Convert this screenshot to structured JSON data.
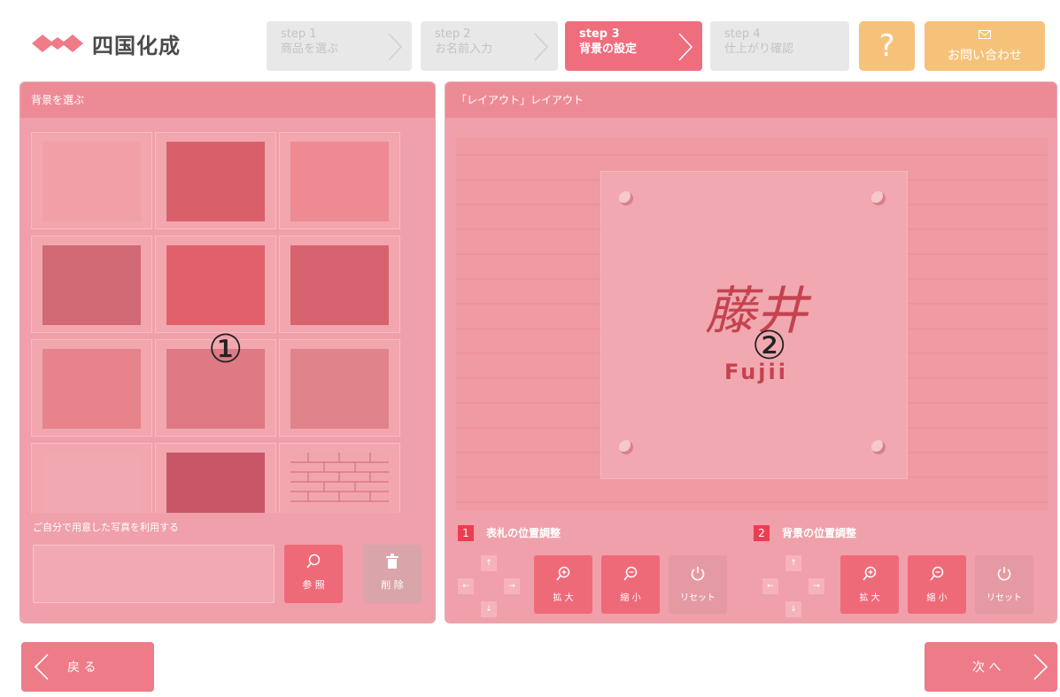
{
  "brand": {
    "name": "四国化成"
  },
  "steps": [
    {
      "title": "step 1",
      "label": "商品を選ぶ"
    },
    {
      "title": "step 2",
      "label": "お名前入力"
    },
    {
      "title": "step 3",
      "label": "背景の設定"
    },
    {
      "title": "step 4",
      "label": "仕上がり確認"
    }
  ],
  "header": {
    "help_label": "?",
    "contact_label": "お問い合わせ"
  },
  "left_panel": {
    "title": "背景を選ぶ",
    "annotation": "①",
    "own_photo_label": "ご自分で用意した写真を利用する",
    "browse_label": "参 照",
    "delete_label": "削 除",
    "swatches": [
      "#f1a0a8",
      "#d95f6b",
      "#ee8a92",
      "#d16a74",
      "#e2606c",
      "#d7636e",
      "#e6838b",
      "#dd7a83",
      "#e1838b",
      "#f1a8b0",
      "#c95666",
      "#f1a6ae"
    ]
  },
  "right_panel": {
    "title": "「レイアウト」レイアウト",
    "annotation": "②",
    "plate_kanji": "藤井",
    "plate_romaji": "Fujii",
    "adjust1": {
      "num": "1",
      "title": "表札の位置調整"
    },
    "adjust2": {
      "num": "2",
      "title": "背景の位置調整"
    },
    "zoom_in": "拡 大",
    "zoom_out": "縮 小",
    "reset": "リセット"
  },
  "footer": {
    "back_label": "戻 る",
    "next_label": "次 へ"
  }
}
